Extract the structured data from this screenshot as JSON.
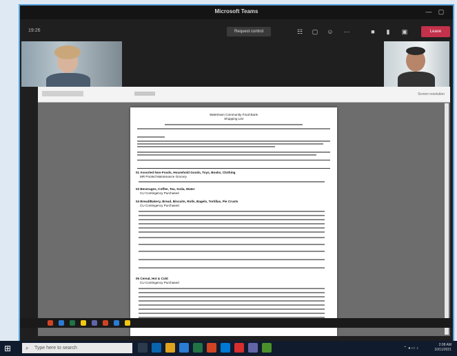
{
  "window": {
    "title": "Microsoft Teams"
  },
  "toolbar": {
    "timer": "19:26",
    "request_control": "Request control",
    "leave": "Leave"
  },
  "share": {
    "stop_label": "Screen resolution",
    "document": {
      "title_lines": [
        "Watertown Community Food Bank",
        "Shopping List"
      ],
      "sections": [
        "01 Assorted Non-Foods, Household Goods, Toys, Books, Clothing",
        "03 Beverages, Coffee, Tea, Soda, Water",
        "04 Bread/Bakery, Bread, Biscuits, Rolls, Bagels, Tortillas, Pie Crusts",
        "05 Cereal, Hot & Cold"
      ],
      "subsections": [
        "MR Pooled Maintenance Grocery",
        "CU Contingency Purchased",
        "CU Contingency Purchased",
        "CU Contingency Purchased"
      ]
    }
  },
  "taskbar": {
    "search_placeholder": "Type here to search",
    "time": "2:08 AM",
    "date": "10/11/2021"
  },
  "colors": {
    "accent": "#5aa4dd",
    "leave": "#c4314b",
    "taskbar": "#101b2e"
  },
  "icons": [
    "windows-logo-icon",
    "search-icon",
    "camera-icon",
    "mic-icon",
    "share-icon",
    "more-icon"
  ]
}
